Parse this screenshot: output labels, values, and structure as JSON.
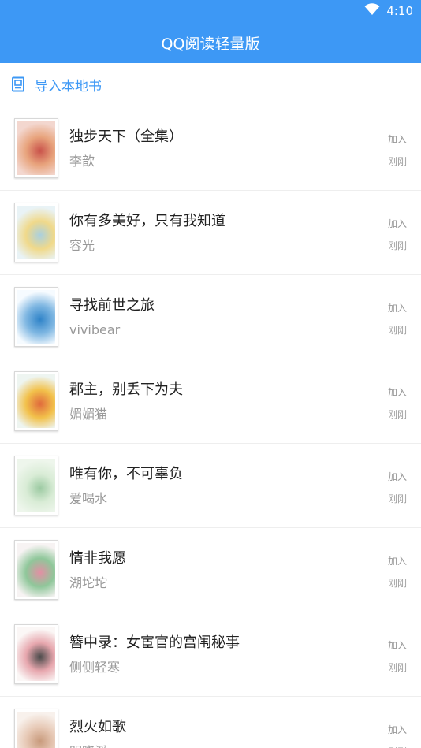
{
  "status": {
    "time": "4:10"
  },
  "app": {
    "title": "QQ阅读轻量版"
  },
  "import": {
    "label": "导入本地书"
  },
  "books": [
    {
      "title": "独步天下（全集）",
      "author": "李歆",
      "added_label": "加入",
      "added_time": "刚刚",
      "cover_colors": [
        "#f3d7cf",
        "#c9524a",
        "#e8a47d"
      ]
    },
    {
      "title": "你有多美好，只有我知道",
      "author": "容光",
      "added_label": "加入",
      "added_time": "刚刚",
      "cover_colors": [
        "#e9f3f6",
        "#a9d0e0",
        "#f0d98a"
      ]
    },
    {
      "title": "寻找前世之旅",
      "author": "vivibear",
      "added_label": "加入",
      "added_time": "刚刚",
      "cover_colors": [
        "#f6fbff",
        "#2f83c8",
        "#7fb7e2"
      ]
    },
    {
      "title": "郡主，别丢下为夫",
      "author": "媚媚猫",
      "added_label": "加入",
      "added_time": "刚刚",
      "cover_colors": [
        "#eef5f1",
        "#e06a3c",
        "#f2c14b"
      ]
    },
    {
      "title": "唯有你，不可辜负",
      "author": "爱喝水",
      "added_label": "加入",
      "added_time": "刚刚",
      "cover_colors": [
        "#eef6ec",
        "#9ccaa2",
        "#d9ecd6"
      ]
    },
    {
      "title": "情非我愿",
      "author": "湖坨坨",
      "added_label": "加入",
      "added_time": "刚刚",
      "cover_colors": [
        "#f7f3f3",
        "#e38fa4",
        "#8fc79a"
      ]
    },
    {
      "title": "簪中录：女宦官的宫闱秘事",
      "author": "侧侧轻寒",
      "added_label": "加入",
      "added_time": "刚刚",
      "cover_colors": [
        "#fbf7f6",
        "#4a4a4a",
        "#e7a7ae"
      ]
    },
    {
      "title": "烈火如歌",
      "author": "明晓溪",
      "added_label": "加入",
      "added_time": "刚刚",
      "cover_colors": [
        "#f8f1ec",
        "#c89a7c",
        "#e7c9b6"
      ]
    }
  ]
}
